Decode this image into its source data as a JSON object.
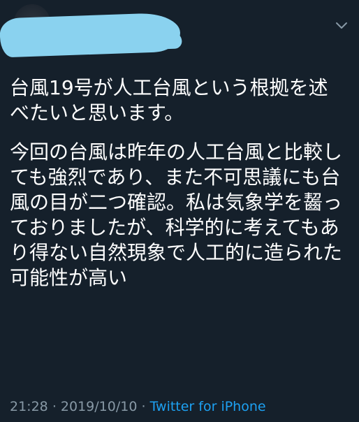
{
  "tweet": {
    "paragraphs": [
      "台風19号が人工台風という根拠を述べたいと思います。",
      "今回の台風は昨年の人工台風と比較しても強烈であり、また不可思議にも台風の目が二つ確認。私は気象学を齧っておりましたが、科学的に考えてもあり得ない自然現象で人工的に造られた可能性が高い"
    ],
    "time": "21:28",
    "separator": "·",
    "date": "2019/10/10",
    "source": "Twitter for iPhone"
  },
  "icons": {
    "menu": "chevron-down-icon"
  },
  "colors": {
    "background": "#15202b",
    "text": "#ffffff",
    "meta": "#8899a6",
    "link": "#1da1f2",
    "redaction": "#8ad2ef"
  }
}
